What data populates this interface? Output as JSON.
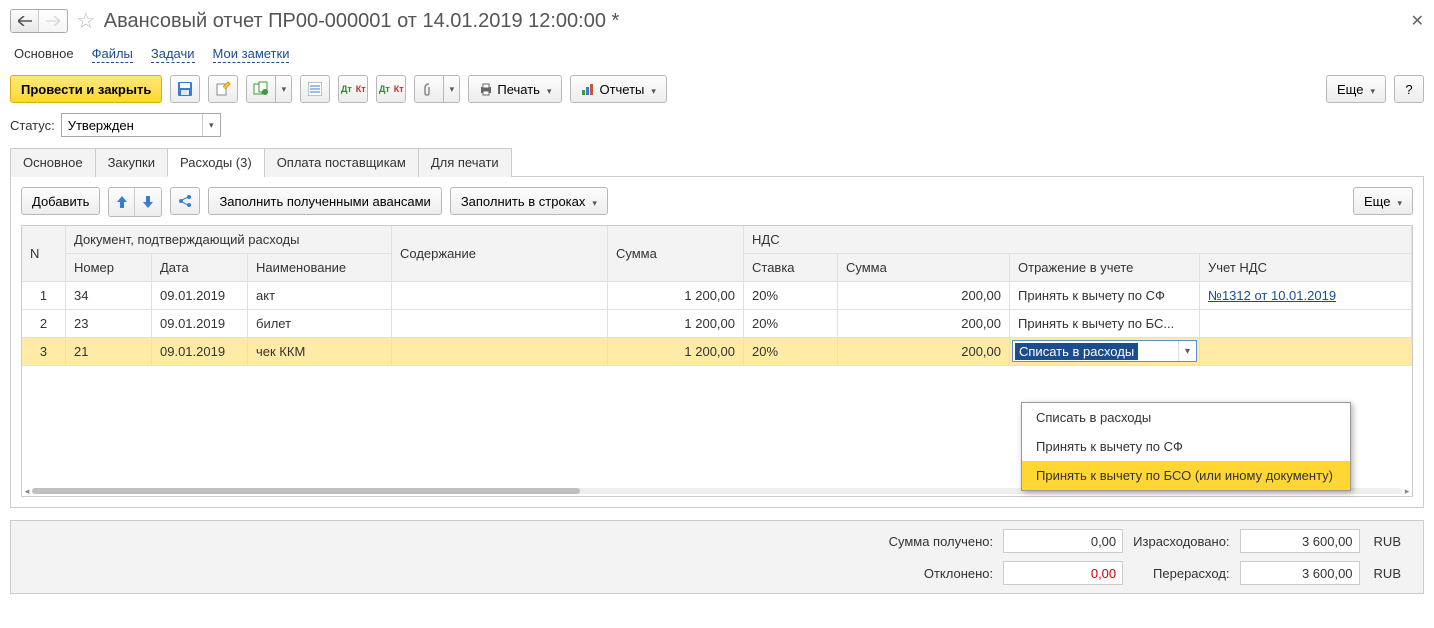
{
  "title": "Авансовый отчет ПР00-000001 от 14.01.2019 12:00:00 *",
  "nav": {
    "main": "Основное",
    "files": "Файлы",
    "tasks": "Задачи",
    "notes": "Мои заметки"
  },
  "toolbar": {
    "post_close": "Провести и закрыть",
    "print": "Печать",
    "reports": "Отчеты",
    "more": "Еще",
    "help": "?"
  },
  "status": {
    "label": "Статус:",
    "value": "Утвержден"
  },
  "tabs": {
    "main": "Основное",
    "purchases": "Закупки",
    "expenses": "Расходы (3)",
    "vendor_pay": "Оплата поставщикам",
    "print": "Для печати"
  },
  "tab_toolbar": {
    "add": "Добавить",
    "fill_advances": "Заполнить полученными авансами",
    "fill_rows": "Заполнить в строках",
    "more": "Еще"
  },
  "grid": {
    "header": {
      "n": "N",
      "doc": "Документ, подтверждающий расходы",
      "num": "Номер",
      "date": "Дата",
      "name": "Наименование",
      "content": "Содержание",
      "sum": "Сумма",
      "nds": "НДС",
      "rate": "Ставка",
      "nds_sum": "Сумма",
      "accounting": "Отражение в учете",
      "vat_acct": "Учет НДС"
    },
    "rows": [
      {
        "n": "1",
        "num": "34",
        "date": "09.01.2019",
        "name": "акт",
        "content": "",
        "sum": "1 200,00",
        "rate": "20%",
        "nds_sum": "200,00",
        "accounting": "Принять к вычету по СФ",
        "vat": "№1312 от 10.01.2019"
      },
      {
        "n": "2",
        "num": "23",
        "date": "09.01.2019",
        "name": "билет",
        "content": "",
        "sum": "1 200,00",
        "rate": "20%",
        "nds_sum": "200,00",
        "accounting": "Принять к вычету по БС...",
        "vat": ""
      },
      {
        "n": "3",
        "num": "21",
        "date": "09.01.2019",
        "name": "чек ККМ",
        "content": "",
        "sum": "1 200,00",
        "rate": "20%",
        "nds_sum": "200,00",
        "accounting": "Списать в расходы",
        "vat": ""
      }
    ]
  },
  "dropdown": {
    "opt1": "Списать в расходы",
    "opt2": "Принять к вычету по СФ",
    "opt3": "Принять к вычету по БСО (или иному документу)"
  },
  "footer": {
    "received_lbl": "Сумма получено:",
    "received_val": "0,00",
    "spent_lbl": "Израсходовано:",
    "spent_val": "3 600,00",
    "declined_lbl": "Отклонено:",
    "declined_val": "0,00",
    "over_lbl": "Перерасход:",
    "over_val": "3 600,00",
    "cur": "RUB"
  }
}
